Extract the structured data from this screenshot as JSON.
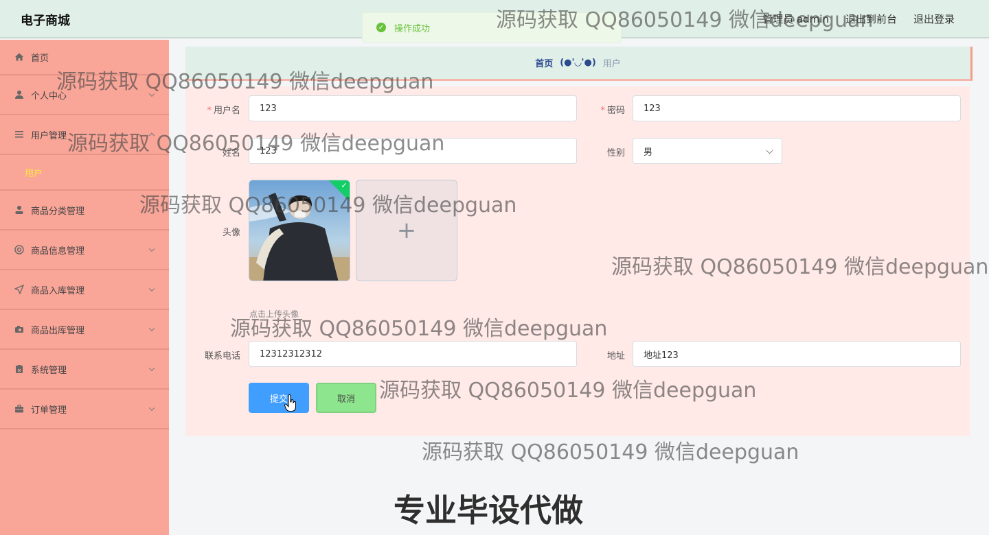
{
  "app": {
    "brand": "电子商城"
  },
  "header": {
    "admin_label": "管理员 admin",
    "front_link": "退出到前台",
    "logout_link": "退出登录"
  },
  "toast": {
    "message": "操作成功"
  },
  "sidebar": {
    "items": [
      {
        "label": "首页",
        "icon": "home-icon"
      },
      {
        "label": "个人中心",
        "icon": "user-icon"
      },
      {
        "label": "用户管理",
        "icon": "list-icon"
      },
      {
        "label": "商品分类管理",
        "icon": "person-icon"
      },
      {
        "label": "商品信息管理",
        "icon": "lifebuoy-icon"
      },
      {
        "label": "商品入库管理",
        "icon": "send-icon"
      },
      {
        "label": "商品出库管理",
        "icon": "camera-icon"
      },
      {
        "label": "系统管理",
        "icon": "clipboard-icon"
      },
      {
        "label": "订单管理",
        "icon": "briefcase-icon"
      }
    ],
    "subitem": "用户"
  },
  "breadcrumb": {
    "home": "首页",
    "separator": "(●'◡'●)",
    "current": "用户"
  },
  "form": {
    "username_label": "用户名",
    "username_value": "123",
    "password_label": "密码",
    "password_value": "123",
    "name_label": "姓名",
    "name_value": "123",
    "gender_label": "性别",
    "gender_value": "男",
    "avatar_label": "头像",
    "avatar_tip": "点击上传头像",
    "phone_label": "联系电话",
    "phone_value": "12312312312",
    "address_label": "地址",
    "address_value": "地址123",
    "submit_label": "提交",
    "cancel_label": "取消"
  },
  "watermark": "源码获取 QQ86050149 微信deepguan",
  "promo": "专业毕设代做",
  "colors": {
    "sidebar": "#f9a598",
    "topbar": "#e0efe8",
    "form_panel": "#ffeae8",
    "submit": "#409eff",
    "cancel": "#8de58d",
    "submenu_active": "#ffeb3b"
  }
}
